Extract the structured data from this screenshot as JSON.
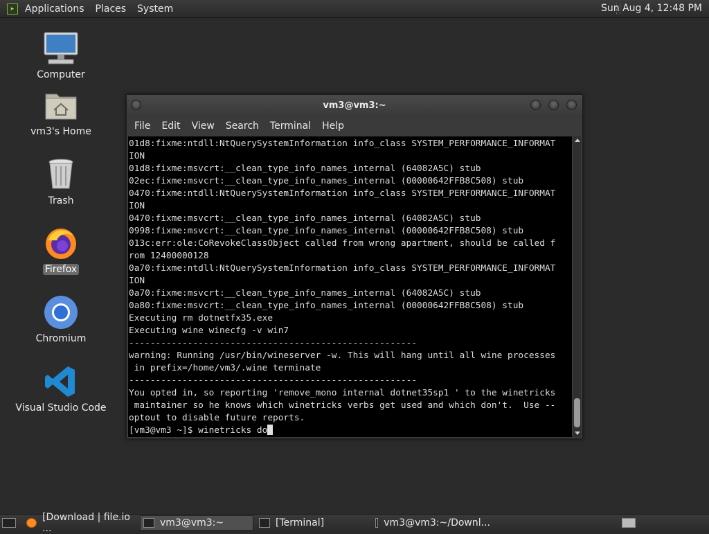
{
  "top_panel": {
    "menus": [
      "Applications",
      "Places",
      "System"
    ],
    "clock": "Sun Aug  4, 12:48 PM"
  },
  "desktop": {
    "icons": [
      {
        "label": "Computer"
      },
      {
        "label": "vm3's Home"
      },
      {
        "label": "Trash"
      },
      {
        "label": "Firefox"
      },
      {
        "label": "Chromium"
      },
      {
        "label": "Visual Studio Code"
      }
    ]
  },
  "terminal": {
    "title": "vm3@vm3:~",
    "menu": [
      "File",
      "Edit",
      "View",
      "Search",
      "Terminal",
      "Help"
    ],
    "lines": [
      "01d8:fixme:ntdll:NtQuerySystemInformation info_class SYSTEM_PERFORMANCE_INFORMAT",
      "ION",
      "01d8:fixme:msvcrt:__clean_type_info_names_internal (64082A5C) stub",
      "02ec:fixme:msvcrt:__clean_type_info_names_internal (00000642FFB8C508) stub",
      "0470:fixme:ntdll:NtQuerySystemInformation info_class SYSTEM_PERFORMANCE_INFORMAT",
      "ION",
      "0470:fixme:msvcrt:__clean_type_info_names_internal (64082A5C) stub",
      "0998:fixme:msvcrt:__clean_type_info_names_internal (00000642FFB8C508) stub",
      "013c:err:ole:CoRevokeClassObject called from wrong apartment, should be called f",
      "rom 12400000128",
      "0a70:fixme:ntdll:NtQuerySystemInformation info_class SYSTEM_PERFORMANCE_INFORMAT",
      "ION",
      "0a70:fixme:msvcrt:__clean_type_info_names_internal (64082A5C) stub",
      "0a80:fixme:msvcrt:__clean_type_info_names_internal (00000642FFB8C508) stub",
      "Executing rm dotnetfx35.exe",
      "Executing wine winecfg -v win7",
      "------------------------------------------------------",
      "warning: Running /usr/bin/wineserver -w. This will hang until all wine processes",
      " in prefix=/home/vm3/.wine terminate",
      "------------------------------------------------------",
      "You opted in, so reporting 'remove_mono internal dotnet35sp1 ' to the winetricks",
      " maintainer so he knows which winetricks verbs get used and which don't.  Use --",
      "optout to disable future reports."
    ],
    "prompt": "[vm3@vm3 ~]$ winetricks do"
  },
  "taskbar": {
    "tasks": [
      {
        "label": "[Download | file.io ..."
      },
      {
        "label": "vm3@vm3:~"
      },
      {
        "label": "[Terminal]"
      },
      {
        "label": "vm3@vm3:~/Downl..."
      }
    ]
  },
  "colors": {
    "desktop_bg": "#2b2b2b",
    "terminal_bg": "#000000",
    "terminal_fg": "#dcdcdc",
    "panel_bg": "#333333"
  }
}
